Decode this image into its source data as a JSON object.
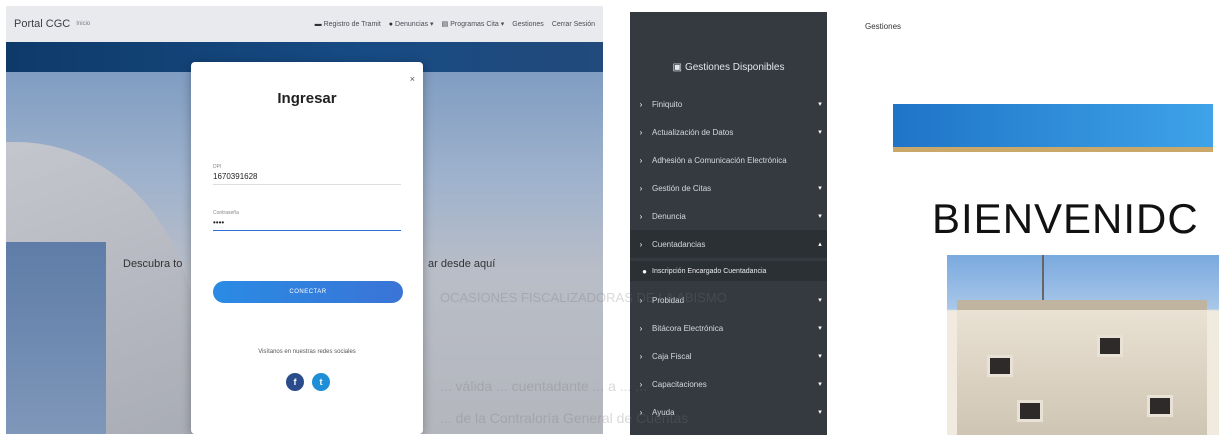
{
  "left": {
    "brand": "Portal CGC",
    "home": "Inicio",
    "nav": [
      {
        "icon": "card-icon",
        "label": "Registro de Tramit"
      },
      {
        "icon": "user-icon",
        "label": "Denuncias ▾"
      },
      {
        "icon": "list-icon",
        "label": "Programas Cita ▾"
      },
      {
        "icon": "",
        "label": "Gestiones"
      },
      {
        "icon": "",
        "label": "Cerrar Sesión"
      }
    ],
    "hero_left": "Descubra to",
    "hero_right": "ar desde aquí",
    "modal": {
      "title": "Ingresar",
      "close": "×",
      "user_label": "DPI",
      "user_value": "1670391628",
      "password_label": "Contraseña",
      "password_value": "••••",
      "connect": "CONECTAR",
      "social_text": "Visítanos en nuestras redes sociales",
      "facebook": "f",
      "twitter": "t"
    }
  },
  "sidebar": {
    "header": "Gestiones Disponibles",
    "items": [
      {
        "label": "Finiquito",
        "chevron": "▾"
      },
      {
        "label": "Actualización de Datos",
        "chevron": "▾"
      },
      {
        "label": "Adhesión a Comunicación Electrónica",
        "chevron": ""
      },
      {
        "label": "Gestión de Citas",
        "chevron": "▾"
      },
      {
        "label": "Denuncia",
        "chevron": "▾"
      },
      {
        "label": "Cuentadancias",
        "chevron": "▴"
      },
      {
        "label": "Probidad",
        "chevron": "▾"
      },
      {
        "label": "Bitácora Electrónica",
        "chevron": "▾"
      },
      {
        "label": "Caja Fiscal",
        "chevron": "▾"
      },
      {
        "label": "Capacitaciones",
        "chevron": "▾"
      },
      {
        "label": "Ayuda",
        "chevron": "▾"
      }
    ],
    "subitem": "Inscripción Encargado Cuentadancia"
  },
  "right": {
    "gestiones": "Gestiones",
    "welcome": "BIENVENIDC"
  },
  "ghost": {
    "mid": "OCASIONES FISCALIZADORAS DE LA ABISMO",
    "bot1": "... válida ... cuentadante ... a ... ...",
    "bot2": "... de la Contraloría General de Cuentas"
  },
  "colors": {
    "accent": "#2f66c1",
    "sidebar_bg": "#343a40",
    "button": "#2a8be4"
  }
}
